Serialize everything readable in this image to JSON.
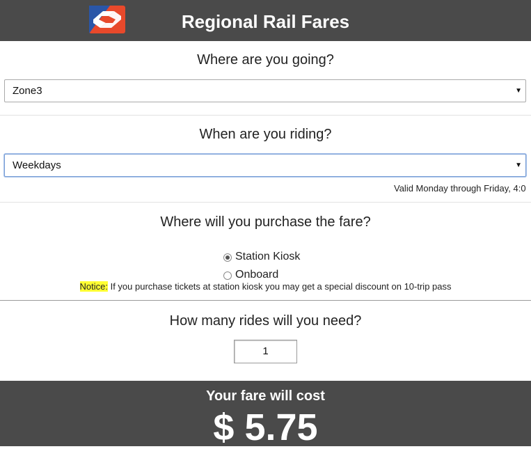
{
  "header": {
    "title": "Regional Rail Fares",
    "logo_icon": "septa-logo-icon",
    "logo_colors": {
      "blue": "#2a56a8",
      "red": "#e8492b"
    }
  },
  "destination": {
    "question": "Where are you going?",
    "selected": "Zone3"
  },
  "time": {
    "question": "When are you riding?",
    "selected": "Weekdays",
    "valid_note": "Valid Monday through Friday, 4:0"
  },
  "purchase": {
    "question": "Where will you purchase the fare?",
    "options": [
      {
        "label": "Station Kiosk",
        "checked": true
      },
      {
        "label": "Onboard",
        "checked": false
      }
    ],
    "notice_tag": "Notice:",
    "notice_text": " If you purchase tickets at station kiosk you may get a special discount on 10-trip pass",
    "notice_highlight_color": "#ffff33"
  },
  "rides": {
    "question": "How many rides will you need?",
    "value": "1"
  },
  "footer": {
    "label": "Your fare will cost",
    "price": "$ 5.75"
  }
}
